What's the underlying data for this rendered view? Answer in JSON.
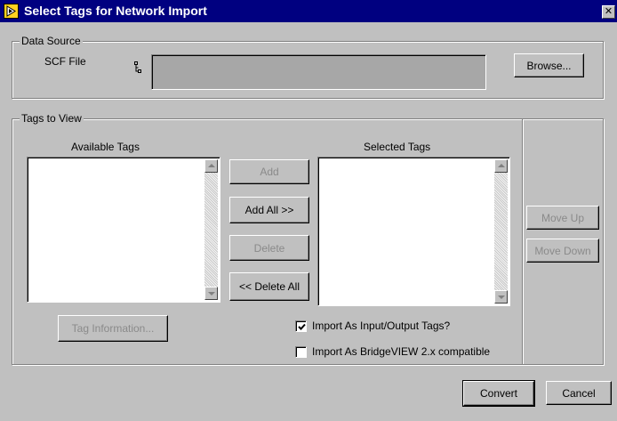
{
  "window": {
    "title": "Select Tags for Network Import",
    "close_glyph": "✕",
    "title_icon": "labview-run-arrow-icon",
    "close_icon": "close-icon"
  },
  "data_source": {
    "legend": "Data Source",
    "scf_label": "SCF File",
    "path_value": "",
    "browse_label": "Browse..."
  },
  "tags_to_view": {
    "legend": "Tags to View",
    "available_label": "Available Tags",
    "selected_label": "Selected Tags",
    "available_items": [],
    "selected_items": [],
    "buttons": {
      "add": "Add",
      "add_all": "Add All >>",
      "delete": "Delete",
      "delete_all": "<< Delete All",
      "tag_information": "Tag Information..."
    },
    "checkboxes": {
      "import_io": {
        "label": "Import As Input/Output Tags?",
        "checked": true
      },
      "bridgeview": {
        "label": "Import As BridgeVIEW 2.x compatible",
        "checked": false
      }
    }
  },
  "order": {
    "move_up": "Move Up",
    "move_down": "Move Down"
  },
  "footer": {
    "convert": "Convert",
    "cancel": "Cancel"
  },
  "colors": {
    "titlebar": "#000080",
    "face": "#c0c0c0",
    "path_field": "#a7a7a7",
    "disabled_text": "#8a8a8a"
  }
}
